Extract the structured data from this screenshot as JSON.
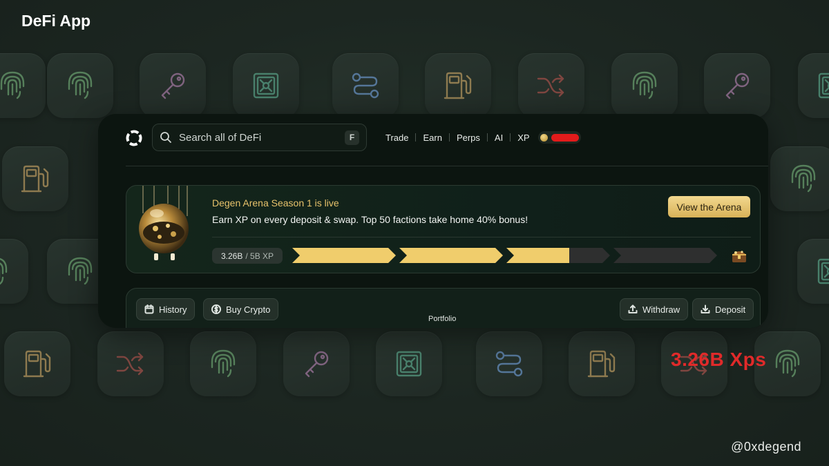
{
  "page": {
    "title": "DeFi App",
    "handle": "@0xdegend",
    "annotation": "3.26B Xps"
  },
  "background_icons": [
    "fingerprint-icon",
    "key-icon",
    "vault-icon",
    "route-icon",
    "gas-pump-icon",
    "shuffle-icon"
  ],
  "colors": {
    "background": "#1c2621",
    "window": "#0c1510",
    "gold": "#e7c26b",
    "annotation_red": "#e02a2a",
    "progress_fill": "#f0cd6c",
    "progress_empty": "#2e2f2f"
  },
  "header": {
    "search_placeholder": "Search all of DeFi",
    "search_shortcut": "F",
    "nav": [
      "Trade",
      "Earn",
      "Perps",
      "AI",
      "XP"
    ]
  },
  "banner": {
    "title": "Degen Arena Season 1 is live",
    "description": "Earn XP on every deposit & swap. Top 50 factions take home 40% bonus!",
    "cta": "View the Arena",
    "xp_current": "3.26B",
    "xp_target": "/ 5B XP",
    "progress_fraction": 0.652
  },
  "panel": {
    "history": "History",
    "buy_crypto": "Buy Crypto",
    "withdraw": "Withdraw",
    "deposit": "Deposit",
    "portfolio": "Portfolio"
  }
}
